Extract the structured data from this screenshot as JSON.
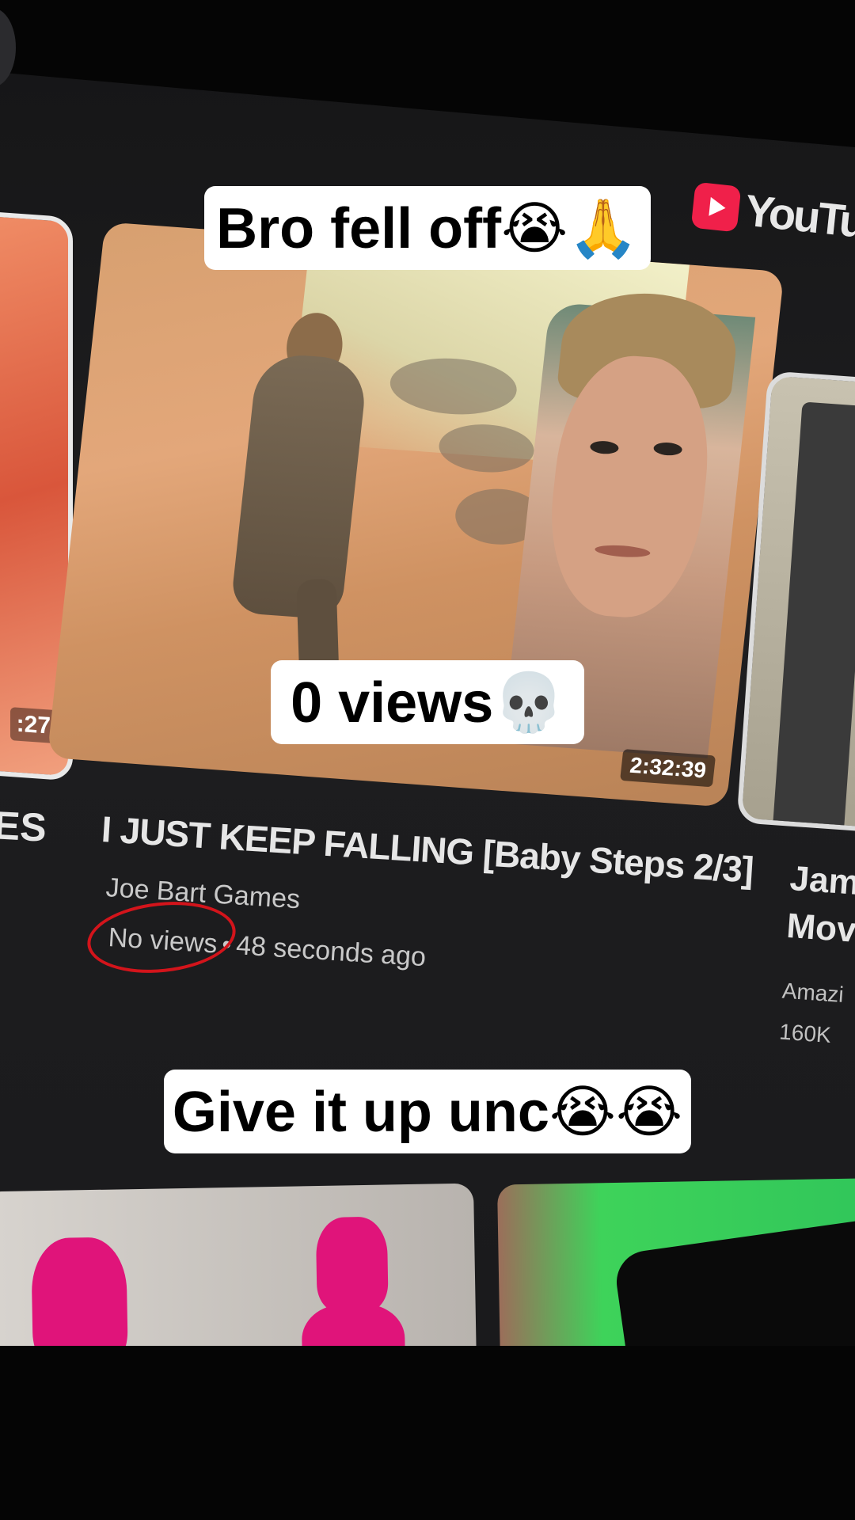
{
  "captions": {
    "top": "Bro fell off😭🙏",
    "middle": "0 views💀",
    "bottom": "Give it up unc😭😭"
  },
  "youtube": {
    "logo_text": "YouTube",
    "brand_color": "#f0204a"
  },
  "left_card": {
    "duration": ":27",
    "title_fragment": "ES"
  },
  "main_video": {
    "duration": "2:32:39",
    "title": "I JUST KEEP FALLING [Baby Steps 2/3]",
    "channel": "Joe Bart Games",
    "views": "No views",
    "separator": "•",
    "age": "48 seconds ago"
  },
  "right_card": {
    "title_line1": "Jame",
    "title_line2": "Movi",
    "channel": "Amazi",
    "views": "160K"
  },
  "colors": {
    "circle_annotation": "#d3141b",
    "caption_bg": "#ffffff"
  }
}
